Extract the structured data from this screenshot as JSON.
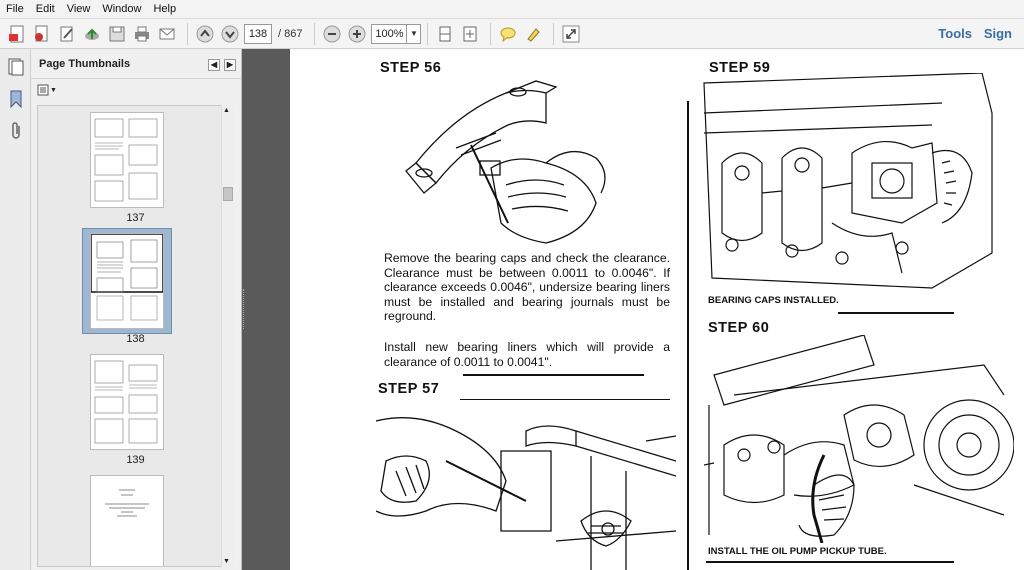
{
  "menu": [
    "File",
    "Edit",
    "View",
    "Window",
    "Help"
  ],
  "toolbar": {
    "page_current": "138",
    "page_total": "/ 867",
    "zoom": "100%",
    "tools_label": "Tools",
    "sign_label": "Sign",
    "icons": [
      "create-pdf-icon",
      "open-icon",
      "edit-icon",
      "cloud-upload-icon",
      "save-icon",
      "print-icon",
      "email-icon",
      "previous-page-icon",
      "next-page-icon",
      "zoom-out-icon",
      "zoom-in-icon",
      "fit-page-icon",
      "fit-width-icon",
      "comment-icon",
      "highlight-icon",
      "expand-icon"
    ]
  },
  "panel": {
    "title": "Page Thumbnails",
    "thumbnails": [
      {
        "label": "137"
      },
      {
        "label": "138",
        "selected": true
      },
      {
        "label": "139"
      },
      {
        "label": ""
      }
    ]
  },
  "document": {
    "step56": "STEP 56",
    "step57": "STEP 57",
    "step59": "STEP 59",
    "step60": "STEP 60",
    "para1": "Remove the bearing caps and check the clearance. Clearance must be between 0.0011 to 0.0046\". If clearance exceeds 0.0046\", undersize bearing liners must be installed and bearing journals must be reground.",
    "para2": "Install new bearing liners which will provide a clearance of 0.0011 to 0.0041\".",
    "caption59": "BEARING CAPS INSTALLED.",
    "caption60": "INSTALL THE OIL PUMP PICKUP TUBE."
  }
}
